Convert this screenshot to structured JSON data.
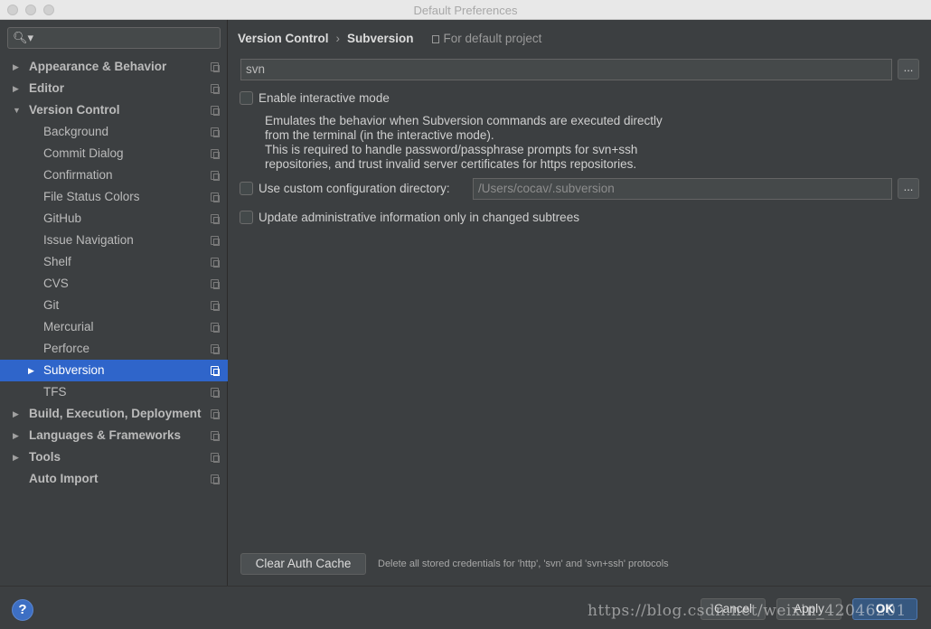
{
  "window": {
    "title": "Default Preferences"
  },
  "search": {
    "placeholder": "",
    "icon": "search-icon"
  },
  "sidebar": {
    "items": [
      {
        "label": "Appearance & Behavior",
        "level": 0,
        "arrow": "right",
        "selected": false
      },
      {
        "label": "Editor",
        "level": 0,
        "arrow": "right",
        "selected": false
      },
      {
        "label": "Version Control",
        "level": 0,
        "arrow": "down",
        "selected": false
      },
      {
        "label": "Background",
        "level": 1,
        "arrow": "",
        "selected": false
      },
      {
        "label": "Commit Dialog",
        "level": 1,
        "arrow": "",
        "selected": false
      },
      {
        "label": "Confirmation",
        "level": 1,
        "arrow": "",
        "selected": false
      },
      {
        "label": "File Status Colors",
        "level": 1,
        "arrow": "",
        "selected": false
      },
      {
        "label": "GitHub",
        "level": 1,
        "arrow": "",
        "selected": false
      },
      {
        "label": "Issue Navigation",
        "level": 1,
        "arrow": "",
        "selected": false
      },
      {
        "label": "Shelf",
        "level": 1,
        "arrow": "",
        "selected": false
      },
      {
        "label": "CVS",
        "level": 1,
        "arrow": "",
        "selected": false
      },
      {
        "label": "Git",
        "level": 1,
        "arrow": "",
        "selected": false
      },
      {
        "label": "Mercurial",
        "level": 1,
        "arrow": "",
        "selected": false
      },
      {
        "label": "Perforce",
        "level": 1,
        "arrow": "",
        "selected": false
      },
      {
        "label": "Subversion",
        "level": 1,
        "arrow": "right",
        "selected": true
      },
      {
        "label": "TFS",
        "level": 1,
        "arrow": "",
        "selected": false
      },
      {
        "label": "Build, Execution, Deployment",
        "level": 0,
        "arrow": "right",
        "selected": false
      },
      {
        "label": "Languages & Frameworks",
        "level": 0,
        "arrow": "right",
        "selected": false
      },
      {
        "label": "Tools",
        "level": 0,
        "arrow": "right",
        "selected": false
      },
      {
        "label": "Auto Import",
        "level": 0,
        "arrow": "",
        "selected": false
      }
    ]
  },
  "breadcrumb": {
    "parent": "Version Control",
    "separator": "›",
    "current": "Subversion",
    "scope": "For default project"
  },
  "main": {
    "executable_path": "svn",
    "browse_label": "...",
    "interactive_mode": {
      "label": "Enable interactive mode",
      "checked": false,
      "description": [
        "Emulates the behavior when Subversion commands are executed directly",
        "from the terminal (in the interactive mode).",
        "This is required to handle password/passphrase prompts for svn+ssh",
        "repositories, and trust invalid server certificates for https repositories."
      ]
    },
    "custom_config": {
      "label": "Use custom configuration directory:",
      "checked": false,
      "path": "/Users/cocav/.subversion"
    },
    "update_admin": {
      "label": "Update administrative information only in changed subtrees",
      "checked": false
    },
    "clear_auth": {
      "button_label": "Clear Auth Cache",
      "note": "Delete all stored credentials for 'http', 'svn' and 'svn+ssh' protocols"
    }
  },
  "footer": {
    "help_label": "?",
    "cancel_label": "Cancel",
    "apply_label": "Apply",
    "ok_label": "OK",
    "watermark": "https://blog.csdn.net/weixin_42046201"
  },
  "colors": {
    "background": "#3c3f41",
    "selection": "#2f65ca",
    "ok_button": "#365880",
    "help_button": "#3d6fc4"
  }
}
